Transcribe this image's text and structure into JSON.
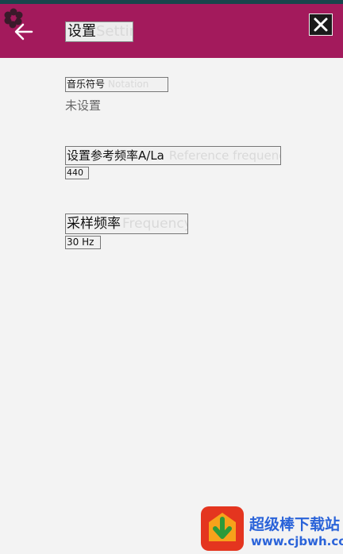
{
  "header": {
    "title": "设置",
    "title_ghost": "Settings"
  },
  "settings": {
    "music_symbol": {
      "label": "音乐符号",
      "ghost": "Notation",
      "value": "未设置"
    },
    "reference_frequency": {
      "label": "设置参考频率A/La",
      "ghost": "Reference frequency A/La",
      "value": "440"
    },
    "sample_rate": {
      "label": "采样频率",
      "ghost": "Frequency",
      "value": "30 Hz"
    }
  },
  "watermark": {
    "name": "超级棒下载站",
    "url": "www.cjbwh.com"
  },
  "colors": {
    "appbar": "#a31a5c",
    "top_stripe": "#17454c",
    "background": "#f3f3f3"
  },
  "icons": {
    "gear": "gear-icon",
    "back": "back-arrow-icon",
    "close": "close-icon"
  }
}
